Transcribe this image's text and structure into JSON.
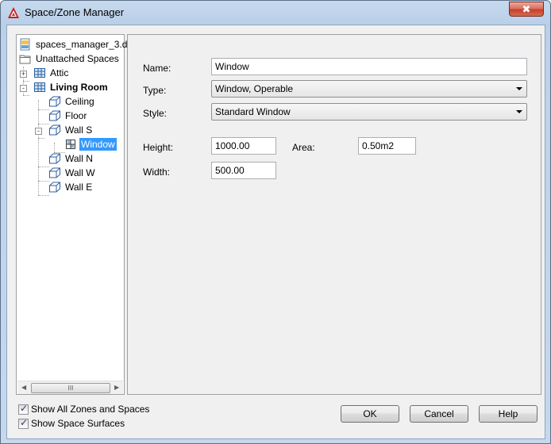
{
  "window": {
    "title": "Space/Zone Manager",
    "close_label": "✖"
  },
  "tree": {
    "items": [
      {
        "label": "spaces_manager_3.d",
        "icon": "drawing-file-icon"
      },
      {
        "label": "Unattached Spaces",
        "icon": "folder-icon"
      },
      {
        "label": "Attic",
        "icon": "space-icon",
        "expander": "+"
      },
      {
        "label": "Living Room",
        "icon": "space-icon",
        "expander": "-"
      },
      {
        "label": "Ceiling",
        "icon": "surface-icon"
      },
      {
        "label": "Floor",
        "icon": "surface-icon"
      },
      {
        "label": "Wall S",
        "icon": "surface-icon",
        "expander": "-"
      },
      {
        "label": "Window",
        "icon": "window-icon"
      },
      {
        "label": "Wall N",
        "icon": "surface-icon"
      },
      {
        "label": "Wall W",
        "icon": "surface-icon"
      },
      {
        "label": "Wall E",
        "icon": "surface-icon"
      }
    ],
    "scroll_thumb": "III"
  },
  "form": {
    "name_label": "Name:",
    "name_value": "Window",
    "type_label": "Type:",
    "type_value": "Window, Operable",
    "style_label": "Style:",
    "style_value": "Standard Window",
    "height_label": "Height:",
    "height_value": "1000.00",
    "area_label": "Area:",
    "area_value": "0.50m2",
    "width_label": "Width:",
    "width_value": "500.00"
  },
  "options": {
    "show_all": "Show All Zones and Spaces",
    "show_all_checked": true,
    "show_surfaces": "Show Space Surfaces",
    "show_surfaces_checked": true
  },
  "buttons": {
    "ok": "OK",
    "cancel": "Cancel",
    "help": "Help"
  },
  "colors": {
    "selection": "#3399ff",
    "close_button": "#c4412c"
  }
}
